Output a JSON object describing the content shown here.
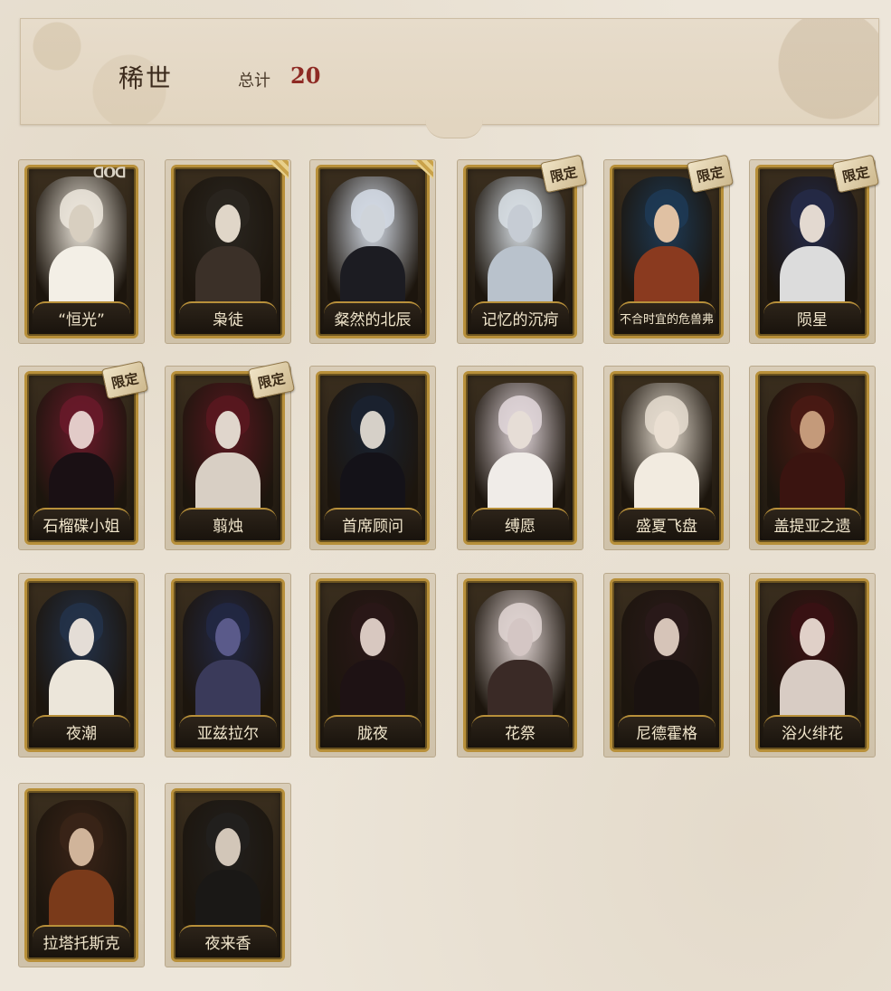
{
  "header": {
    "title": "稀世",
    "total_label": "总计",
    "total_value": "20"
  },
  "badge_label": "限定",
  "corner_text": "ᗡOᗡ",
  "cards": [
    {
      "name": "“恒光”",
      "tag": "corner-text",
      "palette": [
        "#efe9de",
        "#d8cfc0",
        "#f3efe6"
      ]
    },
    {
      "name": "枭徒",
      "tag": "ribbon",
      "palette": [
        "#2a2620",
        "#e0d6c8",
        "#3b3028"
      ]
    },
    {
      "name": "粲然的北辰",
      "tag": "ribbon",
      "palette": [
        "#d6dde8",
        "#cfd4da",
        "#1c1c22"
      ]
    },
    {
      "name": "记忆的沉疴",
      "tag": "limited",
      "palette": [
        "#d9e0e6",
        "#c6ccd4",
        "#b9c2cc"
      ]
    },
    {
      "name": "不合时宜的危兽弗",
      "tag": "limited",
      "palette": [
        "#1d3a56",
        "#e0c1a3",
        "#8a3a1f"
      ]
    },
    {
      "name": "陨星",
      "tag": "limited",
      "palette": [
        "#242a48",
        "#e3d9d0",
        "#dcdcdc"
      ]
    },
    {
      "name": "石榴碟小姐",
      "tag": "limited",
      "palette": [
        "#6a1a2a",
        "#e2cbc8",
        "#1a1014"
      ]
    },
    {
      "name": "翦烛",
      "tag": "limited",
      "palette": [
        "#5a1820",
        "#e0d6cc",
        "#d8cfc4"
      ]
    },
    {
      "name": "首席顾问",
      "tag": "",
      "palette": [
        "#1a2230",
        "#d6d0c8",
        "#141218"
      ]
    },
    {
      "name": "缚愿",
      "tag": "",
      "palette": [
        "#e3d8dc",
        "#e6ddd6",
        "#f0ece8"
      ]
    },
    {
      "name": "盛夏飞盘",
      "tag": "",
      "palette": [
        "#e6ddd0",
        "#eadfd2",
        "#f2ebe0"
      ]
    },
    {
      "name": "盖提亚之遗",
      "tag": "",
      "palette": [
        "#4a1a14",
        "#c49a7a",
        "#3a1410"
      ]
    },
    {
      "name": "夜潮",
      "tag": "",
      "palette": [
        "#23324a",
        "#e4ddd6",
        "#ece6da"
      ]
    },
    {
      "name": "亚兹拉尔",
      "tag": "",
      "palette": [
        "#222844",
        "#5a5a8a",
        "#3a3a5a"
      ]
    },
    {
      "name": "胧夜",
      "tag": "",
      "palette": [
        "#2a1818",
        "#d8c8c0",
        "#1e1214"
      ]
    },
    {
      "name": "花祭",
      "tag": "",
      "palette": [
        "#e2d6d4",
        "#d4c6c4",
        "#3a2a26"
      ]
    },
    {
      "name": "尼德霍格",
      "tag": "",
      "palette": [
        "#2a1a1a",
        "#d6c4b8",
        "#1a1210"
      ]
    },
    {
      "name": "浴火绯花",
      "tag": "",
      "palette": [
        "#3a1214",
        "#e0d0c8",
        "#d8ccc4"
      ]
    },
    {
      "name": "拉塔托斯克",
      "tag": "",
      "palette": [
        "#3a2418",
        "#d0b49a",
        "#7a3a1a"
      ]
    },
    {
      "name": "夜来香",
      "tag": "",
      "palette": [
        "#22201e",
        "#d2c6b8",
        "#1a1816"
      ]
    }
  ]
}
